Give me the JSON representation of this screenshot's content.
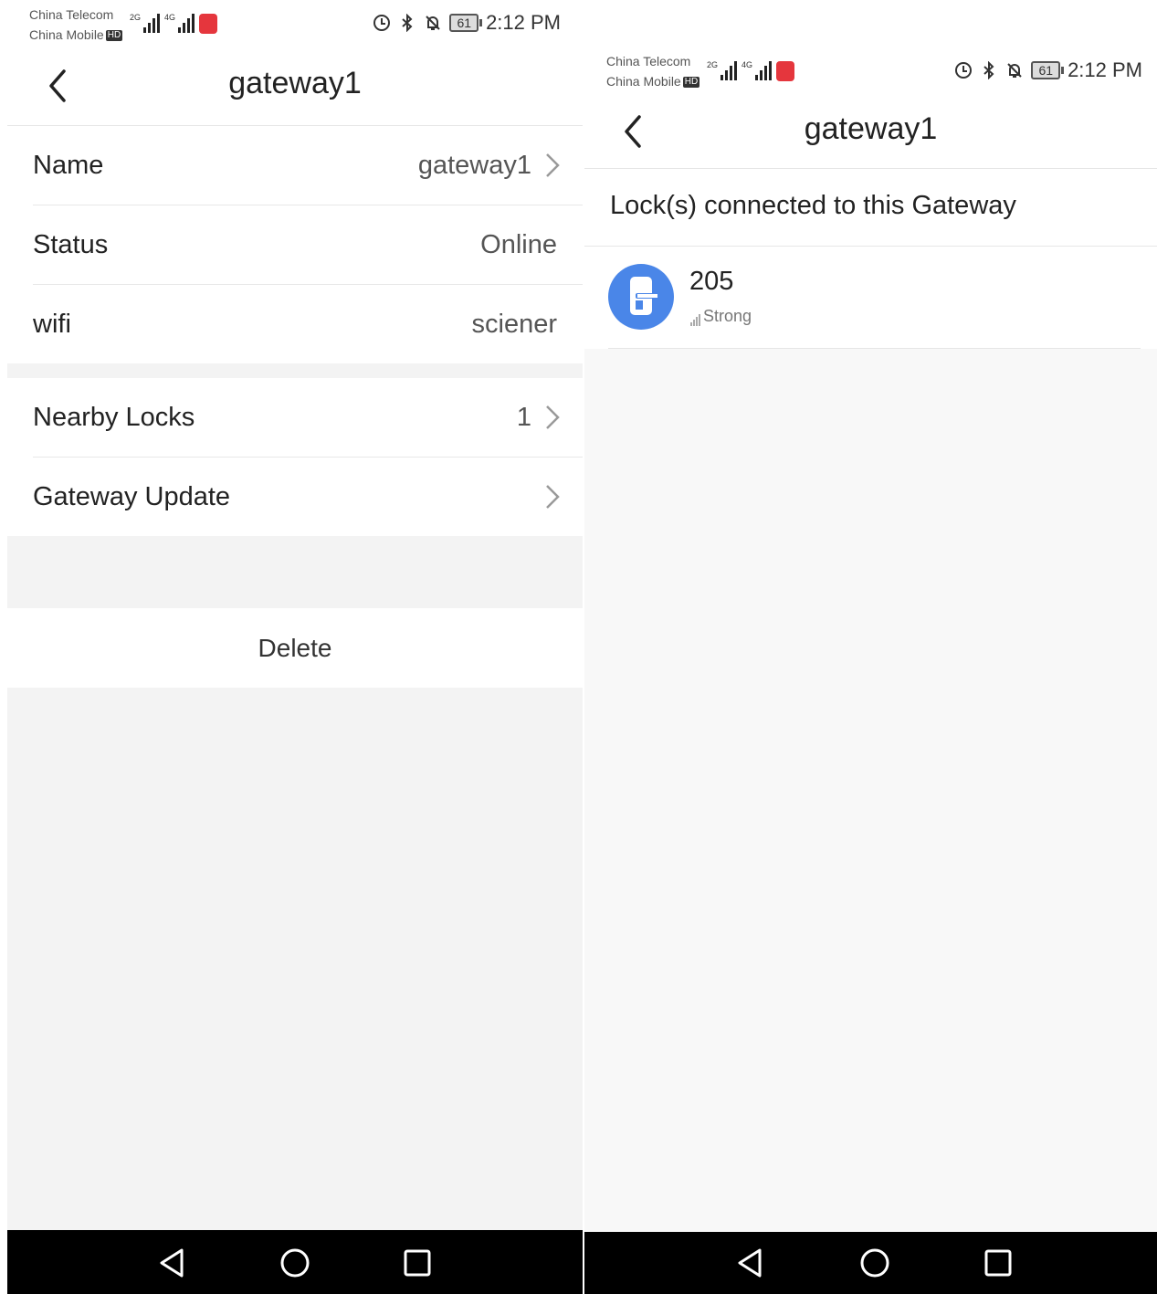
{
  "left_screen": {
    "status": {
      "carrier1": "China Telecom",
      "carrier2": "China Mobile",
      "hd_label": "HD",
      "net1": "2G",
      "net2": "4G",
      "battery": "61",
      "time": "2:12 PM"
    },
    "header": {
      "title": "gateway1",
      "back_icon": "chevron-left-icon"
    },
    "info_rows": [
      {
        "label": "Name",
        "value": "gateway1",
        "chevron": true
      },
      {
        "label": "Status",
        "value": "Online",
        "chevron": false
      },
      {
        "label": "wifi",
        "value": "sciener",
        "chevron": false
      }
    ],
    "action_rows": [
      {
        "label": "Nearby Locks",
        "value": "1",
        "chevron": true
      },
      {
        "label": "Gateway Update",
        "value": "",
        "chevron": true
      }
    ],
    "delete_label": "Delete"
  },
  "right_screen": {
    "status": {
      "carrier1": "China Telecom",
      "carrier2": "China Mobile",
      "hd_label": "HD",
      "net1": "2G",
      "net2": "4G",
      "battery": "61",
      "time": "2:12 PM"
    },
    "header": {
      "title": "gateway1",
      "back_icon": "chevron-left-icon"
    },
    "section_title": "Lock(s) connected to this Gateway",
    "locks": [
      {
        "name": "205",
        "signal": "Strong",
        "icon": "door-lock-icon"
      }
    ]
  },
  "nav_keys": [
    "back-triangle-icon",
    "home-circle-icon",
    "recents-square-icon"
  ],
  "colors": {
    "accent": "#4a86e8",
    "background": "#f3f3f3",
    "navbar": "#000000"
  }
}
